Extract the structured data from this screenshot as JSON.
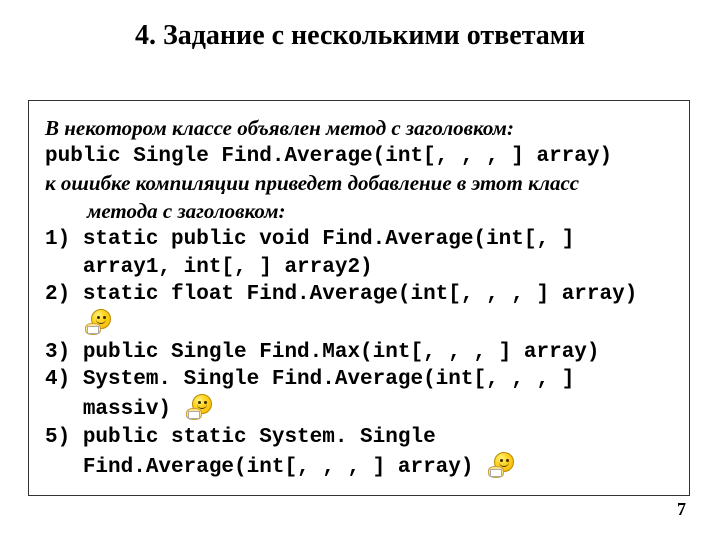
{
  "title": "4. Задание с несколькими ответами",
  "intro": {
    "line1": "В некотором классе объявлен метод с заголовком:",
    "code": "public Single Find.Average(int[, , , ] array)",
    "line2_it": "к ошибке компиляции приведет добавление в этот класс",
    "line2_sub": "метода с заголовком:"
  },
  "options": [
    {
      "num": "1) ",
      "text": "static public void Find.Average(int[, ] array1, int[, ] array2)",
      "smiley": false
    },
    {
      "num": "2) ",
      "text": "static float Find.Average(int[, , , ] array)",
      "smiley": true
    },
    {
      "num": "3) ",
      "text": "public Single Find.Max(int[, , , ] array)",
      "smiley": false
    },
    {
      "num": "4) ",
      "text": "System. Single Find.Average(int[, , , ] massiv)",
      "smiley": true
    },
    {
      "num": "5) ",
      "text": "public static System. Single Find.Average(int[, , , ] array)",
      "smiley": true
    }
  ],
  "page_number": "7"
}
